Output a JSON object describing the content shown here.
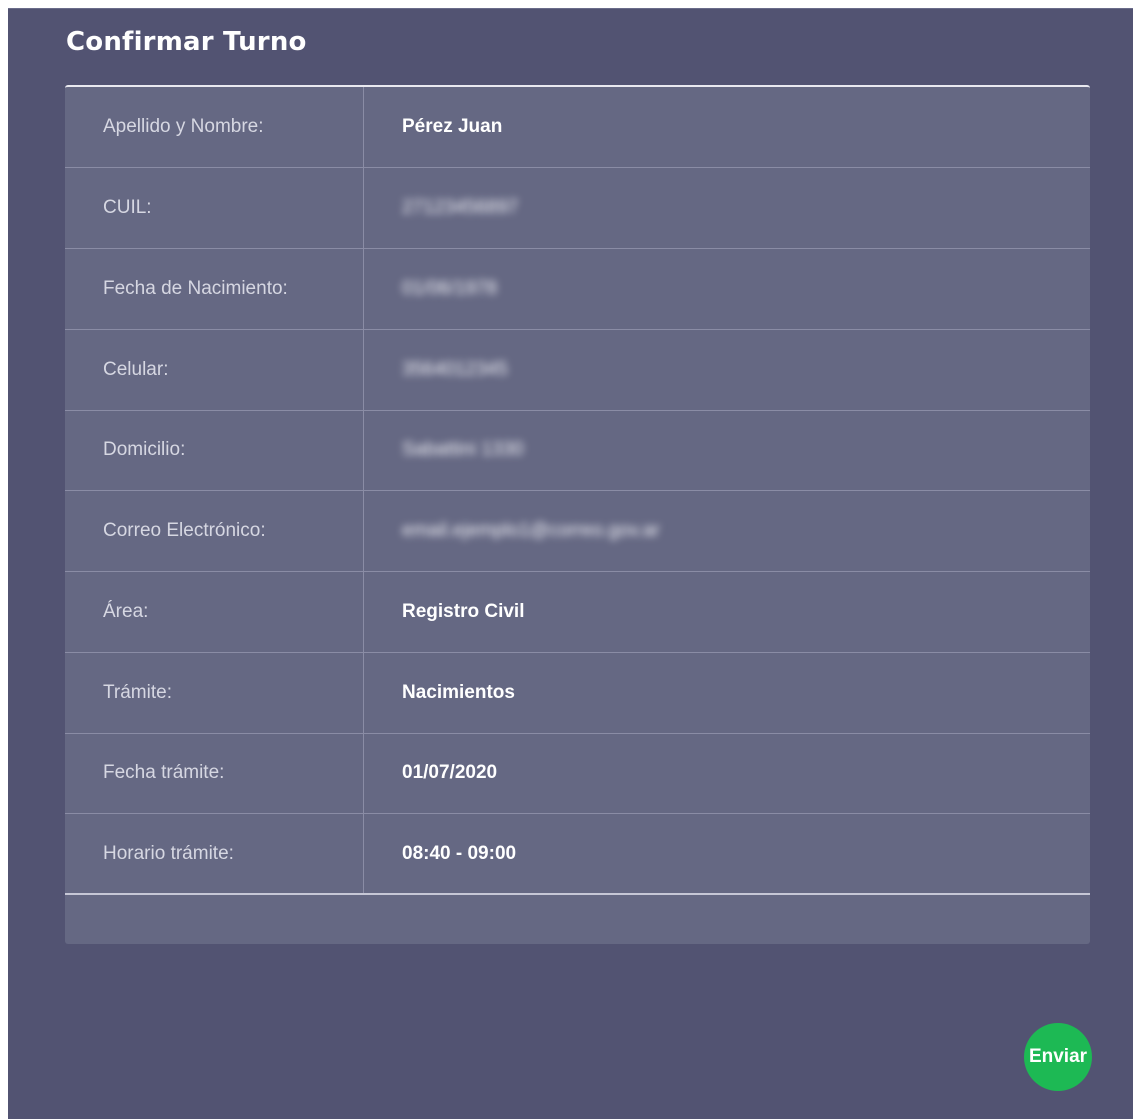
{
  "form": {
    "title": "Confirmar Turno",
    "rows": [
      {
        "label": "Apellido y Nombre:",
        "value": "Pérez Juan",
        "blurred": false
      },
      {
        "label": "CUIL:",
        "value": "27123456897",
        "blurred": true
      },
      {
        "label": "Fecha de Nacimiento:",
        "value": "01/06/1978",
        "blurred": true
      },
      {
        "label": "Celular:",
        "value": "3564012345",
        "blurred": true
      },
      {
        "label": "Domicilio:",
        "value": "Sabattini 1330",
        "blurred": true
      },
      {
        "label": "Correo Electrónico:",
        "value": "email.ejemplo1@correo.gov.ar",
        "blurred": true
      },
      {
        "label": "Área:",
        "value": "Registro Civil",
        "blurred": false
      },
      {
        "label": "Trámite:",
        "value": "Nacimientos",
        "blurred": false
      },
      {
        "label": "Fecha trámite:",
        "value": "01/07/2020",
        "blurred": false
      },
      {
        "label": "Horario trámite:",
        "value": "08:40 - 09:00",
        "blurred": false
      }
    ]
  },
  "actions": {
    "send_label": "Enviar"
  },
  "colors": {
    "panel_bg": "#525372",
    "card_bg": "#656883",
    "send_button": "#1db954"
  }
}
